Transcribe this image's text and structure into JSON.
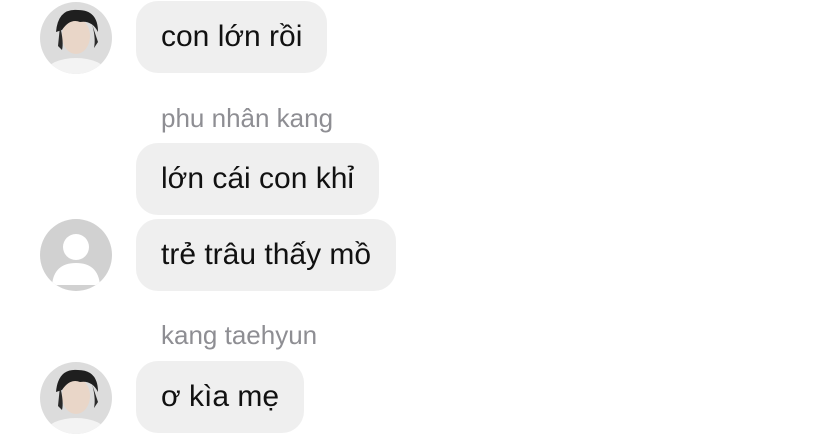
{
  "colors": {
    "background": "#ffffff",
    "bubble": "#efefef",
    "text": "#111111",
    "sender_name": "#8e8e93",
    "placeholder_avatar": "#d1d1d1"
  },
  "messages": [
    {
      "text": "con lớn rồi",
      "avatar": "profile-photo-avatar"
    },
    {
      "sender": "phu nhân kang",
      "text": "lớn cái con khỉ"
    },
    {
      "text": "trẻ trâu thấy mồ",
      "avatar": "default-user-avatar"
    },
    {
      "sender": "kang taehyun",
      "text": "ơ kìa mẹ",
      "avatar": "profile-photo-avatar"
    }
  ]
}
